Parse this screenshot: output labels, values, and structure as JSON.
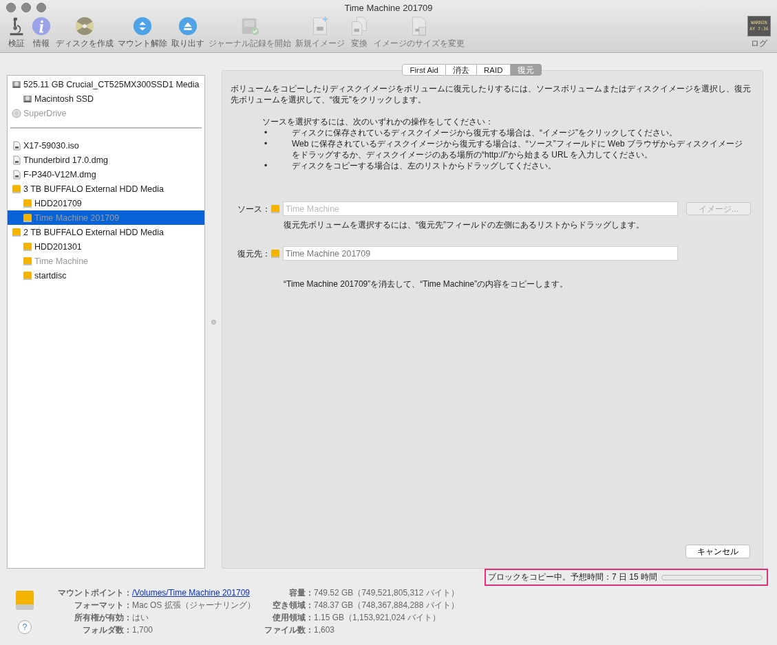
{
  "window": {
    "title": "Time Machine 201709"
  },
  "toolbar": [
    {
      "label": "検証",
      "kind": "microscope",
      "disabled": false
    },
    {
      "label": "情報",
      "kind": "info",
      "disabled": false
    },
    {
      "label": "ディスクを作成",
      "kind": "burn",
      "disabled": false
    },
    {
      "label": "マウント解除",
      "kind": "unmount",
      "disabled": false
    },
    {
      "label": "取り出す",
      "kind": "eject",
      "disabled": false
    },
    {
      "label": "ジャーナル記録を開始",
      "kind": "journal",
      "disabled": true
    },
    {
      "label": "新規イメージ",
      "kind": "newimage",
      "disabled": true
    },
    {
      "label": "変換",
      "kind": "convert",
      "disabled": true
    },
    {
      "label": "イメージのサイズを変更",
      "kind": "resize",
      "disabled": true
    }
  ],
  "log": {
    "label": "ログ",
    "lines": [
      "WARNIN",
      "AY 7:36"
    ]
  },
  "sidebar": {
    "groups": [
      [
        {
          "label": "525.11 GB Crucial_CT525MX300SSD1 Media",
          "kind": "hdd",
          "disabled": false,
          "selected": false,
          "children": [
            {
              "label": "Macintosh SSD",
              "kind": "hdd",
              "disabled": false,
              "selected": false
            }
          ]
        },
        {
          "label": "SuperDrive",
          "kind": "optical",
          "disabled": true,
          "selected": false
        }
      ],
      [
        {
          "label": "X17-59030.iso",
          "kind": "image",
          "disabled": false,
          "selected": false
        },
        {
          "label": "Thunderbird 17.0.dmg",
          "kind": "image",
          "disabled": false,
          "selected": false
        },
        {
          "label": "F-P340-V12M.dmg",
          "kind": "image",
          "disabled": false,
          "selected": false
        },
        {
          "label": "3 TB BUFFALO External HDD Media",
          "kind": "external",
          "disabled": false,
          "selected": false,
          "children": [
            {
              "label": "HDD201709",
              "kind": "external",
              "disabled": false,
              "selected": false
            },
            {
              "label": "Time Machine 201709",
              "kind": "external",
              "disabled": true,
              "selected": true
            }
          ]
        },
        {
          "label": "2 TB BUFFALO External HDD Media",
          "kind": "external",
          "disabled": false,
          "selected": false,
          "children": [
            {
              "label": "HDD201301",
              "kind": "external",
              "disabled": false,
              "selected": false
            },
            {
              "label": "Time Machine",
              "kind": "external",
              "disabled": true,
              "selected": false
            },
            {
              "label": "startdisc",
              "kind": "external",
              "disabled": false,
              "selected": false
            }
          ]
        }
      ]
    ]
  },
  "tabs": [
    {
      "label": "First Aid",
      "selected": false
    },
    {
      "label": "消去",
      "selected": false
    },
    {
      "label": "RAID",
      "selected": false
    },
    {
      "label": "復元",
      "selected": true
    }
  ],
  "restore": {
    "intro": "ボリュームをコピーしたりディスクイメージをボリュームに復元したりするには、ソースボリュームまたはディスクイメージを選択し、復元先ボリュームを選択して、“復元”をクリックします。",
    "steps_heading": "ソースを選択するには、次のいずれかの操作をしてください：",
    "steps": [
      {
        "bullet": "•",
        "text": "ディスクに保存されているディスクイメージから復元する場合は、“イメージ”をクリックしてください。"
      },
      {
        "bullet": "•",
        "text": "Web に保存されているディスクイメージから復元する場合は、“ソース”フィールドに Web ブラウザからディスクイメージをドラッグするか、ディスクイメージのある場所の“http://”から始まる URL を入力してください。"
      },
      {
        "bullet": "•",
        "text": "ディスクをコピーする場合は、左のリストからドラッグしてください。"
      }
    ],
    "source": {
      "label": "ソース：",
      "value": "Time Machine",
      "disabled": true
    },
    "image_button": {
      "label": "イメージ...",
      "disabled": true
    },
    "source_hint": "復元先ボリュームを選択するには、“復元先”フィールドの左側にあるリストからドラッグします。",
    "destination": {
      "label": "復元先：",
      "value": "Time Machine 201709",
      "disabled": false
    },
    "summary": "“Time Machine 201709”を消去して、“Time Machine”の内容をコピーします。",
    "cancel_button": "キャンセル"
  },
  "status": {
    "text": "ブロックをコピー中。予想時間：7 日 15 時間",
    "level": 0,
    "highlighted": true
  },
  "info": {
    "left": [
      {
        "label": "マウントポイント：",
        "value": "/Volumes/Time Machine 201709",
        "kind": "link"
      },
      {
        "label": "フォーマット：",
        "value": "Mac OS 拡張（ジャーナリング）",
        "kind": "text"
      },
      {
        "label": "所有権が有効：",
        "value": "はい",
        "kind": "text"
      },
      {
        "label": "フォルダ数：",
        "value": "1,700",
        "kind": "text"
      }
    ],
    "right": [
      {
        "label": "容量：",
        "value": "749.52 GB（749,521,805,312 バイト）"
      },
      {
        "label": "空き領域：",
        "value": "748.37 GB（748,367,884,288 バイト）"
      },
      {
        "label": "使用領域：",
        "value": "1.15 GB（1,153,921,024 バイト）"
      },
      {
        "label": "ファイル数：",
        "value": "1,603"
      }
    ]
  },
  "help_button": "?"
}
